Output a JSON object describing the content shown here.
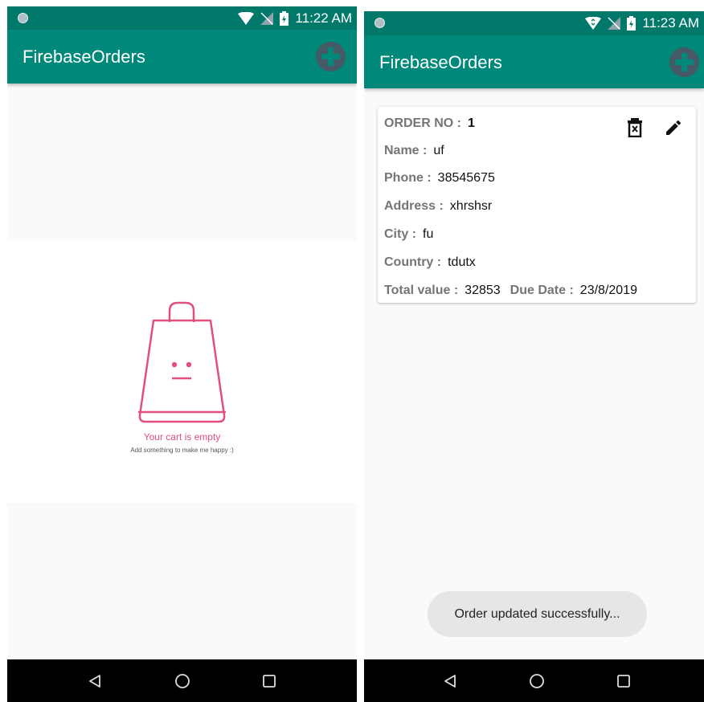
{
  "colors": {
    "accent": "#00897b",
    "status_bar": "#00796b",
    "empty_pink": "#e0507a"
  },
  "left_screen": {
    "status_bar": {
      "time": "11:22 AM"
    },
    "app_bar": {
      "title": "FirebaseOrders",
      "add_icon": "add-circle-icon"
    },
    "empty_state": {
      "icon": "shopping-bag-icon",
      "title": "Your cart is empty",
      "subtitle": "Add something to make me happy :)"
    },
    "nav_bar": {
      "icons": [
        "back-triangle-icon",
        "home-circle-icon",
        "recents-square-icon"
      ]
    }
  },
  "right_screen": {
    "status_bar": {
      "time": "11:23 AM"
    },
    "app_bar": {
      "title": "FirebaseOrders",
      "add_icon": "add-circle-icon"
    },
    "order": {
      "order_no_label": "ORDER NO :",
      "order_no": "1",
      "name_label": "Name :",
      "name": "uf",
      "phone_label": "Phone :",
      "phone": "38545675",
      "address_label": "Address :",
      "address": "xhrshsr",
      "city_label": "City :",
      "city": "fu",
      "country_label": "Country :",
      "country": "tdutx",
      "total_label": "Total value :",
      "total": "32853",
      "due_label": "Due Date :",
      "due": "23/8/2019",
      "delete_icon": "delete-icon",
      "edit_icon": "edit-pencil-icon"
    },
    "toast": "Order updated successfully...",
    "nav_bar": {
      "icons": [
        "back-triangle-icon",
        "home-circle-icon",
        "recents-square-icon"
      ]
    }
  }
}
